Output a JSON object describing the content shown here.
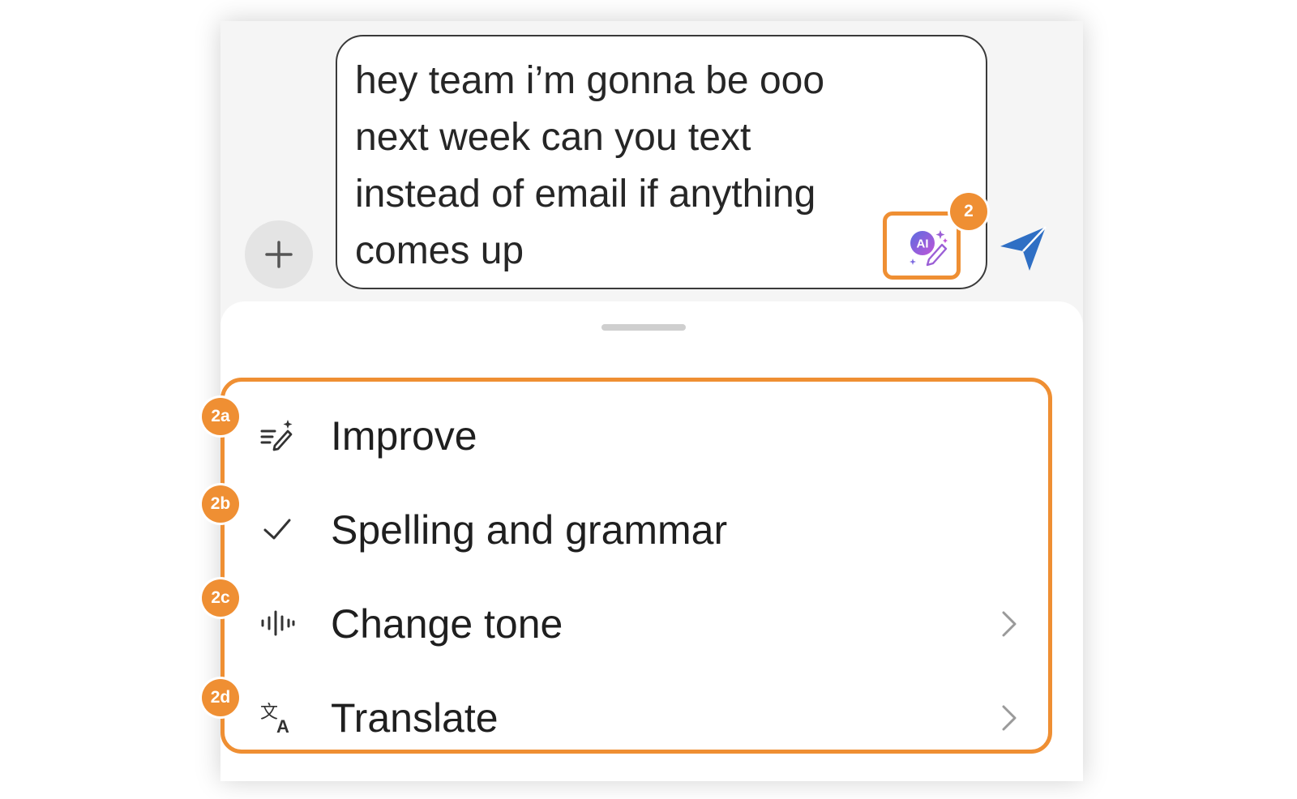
{
  "composer": {
    "message": "hey team i’m gonna be ooo\nnext week can you text\ninstead of email if anything\ncomes up",
    "plus_icon": "plus-icon",
    "ai_icon": "ai-writing-assist-icon",
    "send_icon": "send-paper-plane-icon"
  },
  "menu": {
    "items": [
      {
        "label": "Improve",
        "icon": "improve-sparkle-pencil-icon",
        "has_submenu": false,
        "badge": "2a"
      },
      {
        "label": "Spelling and grammar",
        "icon": "checkmark-icon",
        "has_submenu": false,
        "badge": "2b"
      },
      {
        "label": "Change tone",
        "icon": "waveform-icon",
        "has_submenu": true,
        "badge": "2c"
      },
      {
        "label": "Translate",
        "icon": "translate-icon",
        "has_submenu": true,
        "badge": "2d"
      }
    ]
  },
  "annotations": {
    "ai_button_badge": "2",
    "accent_color": "#ef8f33"
  },
  "colors": {
    "send": "#2f6fc4",
    "ai_gradient_start": "#5b6de0",
    "ai_gradient_end": "#c054d8"
  }
}
